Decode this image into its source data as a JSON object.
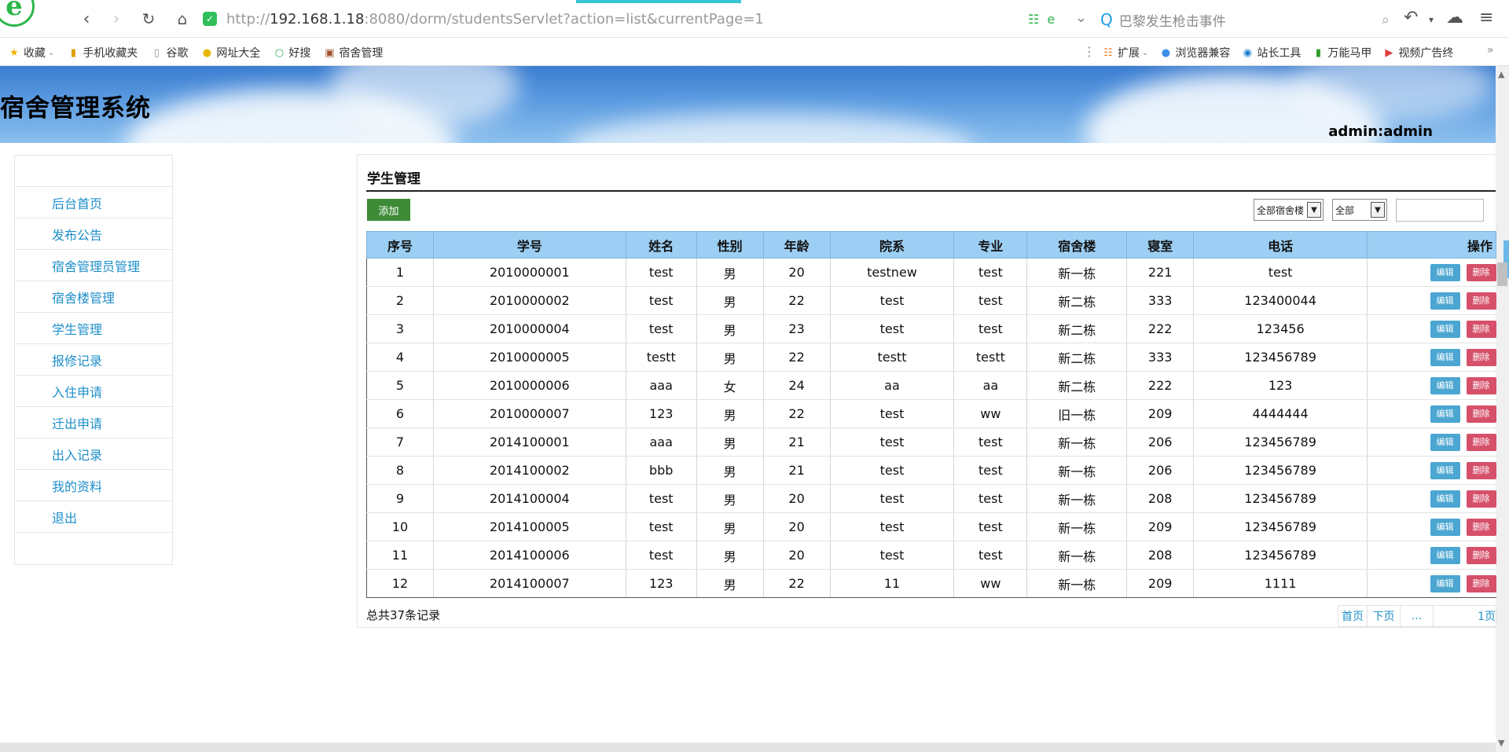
{
  "browser": {
    "url_prefix": "http://",
    "url_host": "192.168.1.18",
    "url_rest": ":8080/dorm/studentsServlet?action=list&currentPage=1",
    "search_placeholder": "巴黎发生枪击事件",
    "bookmarks_left": [
      "收藏",
      "手机收藏夹",
      "谷歌",
      "网址大全",
      "好搜",
      "宿舍管理"
    ],
    "bookmarks_right": [
      "扩展",
      "浏览器兼容",
      "站长工具",
      "万能马甲",
      "视频广告终"
    ]
  },
  "header": {
    "title": "宿舍管理系统",
    "user": "admin:admin"
  },
  "sidebar": {
    "items": [
      "后台首页",
      "发布公告",
      "宿舍管理员管理",
      "宿舍楼管理",
      "学生管理",
      "报修记录",
      "入住申请",
      "迁出申请",
      "出入记录",
      "我的资料",
      "退出"
    ]
  },
  "main": {
    "title": "学生管理",
    "add_label": "添加",
    "filter_building": "全部宿舍楼",
    "filter_all": "全部",
    "search_value": "",
    "columns": [
      "序号",
      "学号",
      "姓名",
      "性别",
      "年龄",
      "院系",
      "专业",
      "宿舍楼",
      "寝室",
      "电话",
      "操作"
    ],
    "edit_label": "编辑",
    "delete_label": "删除",
    "rows": [
      [
        "1",
        "2010000001",
        "test",
        "男",
        "20",
        "testnew",
        "test",
        "新一栋",
        "221",
        "test"
      ],
      [
        "2",
        "2010000002",
        "test",
        "男",
        "22",
        "test",
        "test",
        "新二栋",
        "333",
        "123400044"
      ],
      [
        "3",
        "2010000004",
        "test",
        "男",
        "23",
        "test",
        "test",
        "新二栋",
        "222",
        "123456"
      ],
      [
        "4",
        "2010000005",
        "testt",
        "男",
        "22",
        "testt",
        "testt",
        "新二栋",
        "333",
        "123456789"
      ],
      [
        "5",
        "2010000006",
        "aaa",
        "女",
        "24",
        "aa",
        "aa",
        "新二栋",
        "222",
        "123"
      ],
      [
        "6",
        "2010000007",
        "123",
        "男",
        "22",
        "test",
        "ww",
        "旧一栋",
        "209",
        "4444444"
      ],
      [
        "7",
        "2014100001",
        "aaa",
        "男",
        "21",
        "test",
        "test",
        "新一栋",
        "206",
        "123456789"
      ],
      [
        "8",
        "2014100002",
        "bbb",
        "男",
        "21",
        "test",
        "test",
        "新一栋",
        "206",
        "123456789"
      ],
      [
        "9",
        "2014100004",
        "test",
        "男",
        "20",
        "test",
        "test",
        "新一栋",
        "208",
        "123456789"
      ],
      [
        "10",
        "2014100005",
        "test",
        "男",
        "20",
        "test",
        "test",
        "新一栋",
        "209",
        "123456789"
      ],
      [
        "11",
        "2014100006",
        "test",
        "男",
        "20",
        "test",
        "test",
        "新一栋",
        "208",
        "123456789"
      ],
      [
        "12",
        "2014100007",
        "123",
        "男",
        "22",
        "11",
        "ww",
        "新一栋",
        "209",
        "1111"
      ]
    ],
    "total": "总共37条记录",
    "pager": [
      "首页",
      "下页",
      "...",
      "1页"
    ]
  },
  "colors": {
    "header_bg": "#9dcff4",
    "add_button": "#3d8b37",
    "edit_button": "#4ba6d1",
    "delete_button": "#d6506a",
    "link": "#1e8fc9"
  }
}
